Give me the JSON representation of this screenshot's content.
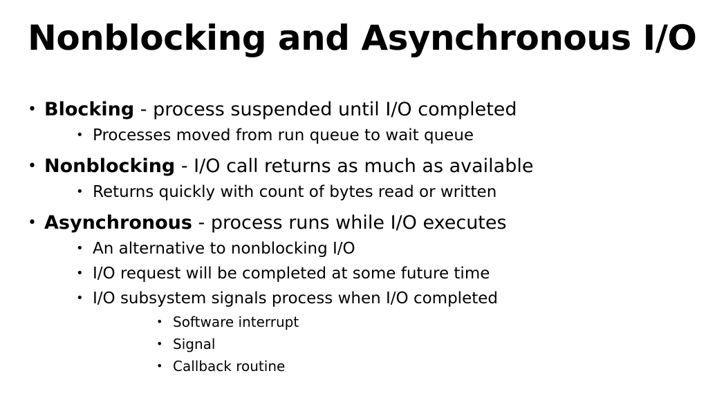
{
  "slide": {
    "title": "Nonblocking and Asynchronous I/O",
    "bullets": [
      {
        "term": "Blocking",
        "text": " - process suspended until I/O completed",
        "subs": [
          {
            "text": "Processes moved from run queue to wait queue"
          }
        ]
      },
      {
        "term": "Nonblocking",
        "text": " - I/O call returns as much as available",
        "subs": [
          {
            "text": "Returns quickly with count of bytes read or written"
          }
        ]
      },
      {
        "term": "Asynchronous",
        "text": " - process runs while I/O executes",
        "subs": [
          {
            "text": "An alternative to nonblocking I/O"
          },
          {
            "text": "I/O request will be completed at some future time"
          },
          {
            "text": "I/O subsystem signals process when I/O completed",
            "subs": [
              {
                "text": "Software interrupt"
              },
              {
                "text": "Signal"
              },
              {
                "text": "Callback routine"
              }
            ]
          }
        ]
      }
    ],
    "bullet_glyph": "•"
  }
}
